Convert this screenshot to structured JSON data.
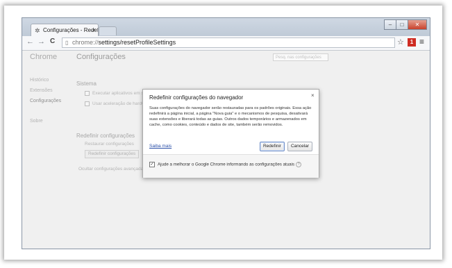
{
  "window": {
    "tab_title": "Configurações - Redefinir",
    "tab_close": "×",
    "minimize": "–",
    "restore": "□",
    "close": "✕"
  },
  "toolbar": {
    "back": "←",
    "forward": "→",
    "reload": "C",
    "url_host": "chrome://",
    "url_path": "settings/resetProfileSettings",
    "bookmark_star": "☆",
    "extension_badge": "1",
    "menu": "≡"
  },
  "sidebar": {
    "title": "Chrome",
    "items": [
      {
        "label": "Histórico"
      },
      {
        "label": "Extensões"
      },
      {
        "label": "Configurações"
      },
      {
        "label": "Sobre"
      }
    ]
  },
  "settings": {
    "title": "Configurações",
    "search_placeholder": "Pesq. nas configurações",
    "system_heading": "Sistema",
    "option1": "Executar aplicativos em segundo plano quando o Google Chrome estiver fechado",
    "option2": "Usar aceleração de hardware quando disponível",
    "reset_heading": "Redefinir configurações",
    "reset_desc": "Restaurar configurações",
    "reset_button": "Redefinir configurações",
    "hide_advanced": "Ocultar configurações avançadas"
  },
  "dialog": {
    "title": "Redefinir configurações do navegador",
    "close": "×",
    "body": "Suas configurações do navegador serão restauradas para os padrões originais. Essa ação redefinirá a página inicial, a página \"Nova guia\" e o mecanismos de pesquisa, desativará suas extensões e liberará todas as guias. Outros dados temporários e armazenados em cache, como cookies, conteúdo e dados de site, também serão removidos.",
    "learn_more": "Saiba mais",
    "reset_button": "Redefinir",
    "cancel_button": "Cancelar",
    "checkbox_label": "Ajude a melhorar o Google Chrome informando as configurações atuais",
    "checkbox_checked": true
  }
}
